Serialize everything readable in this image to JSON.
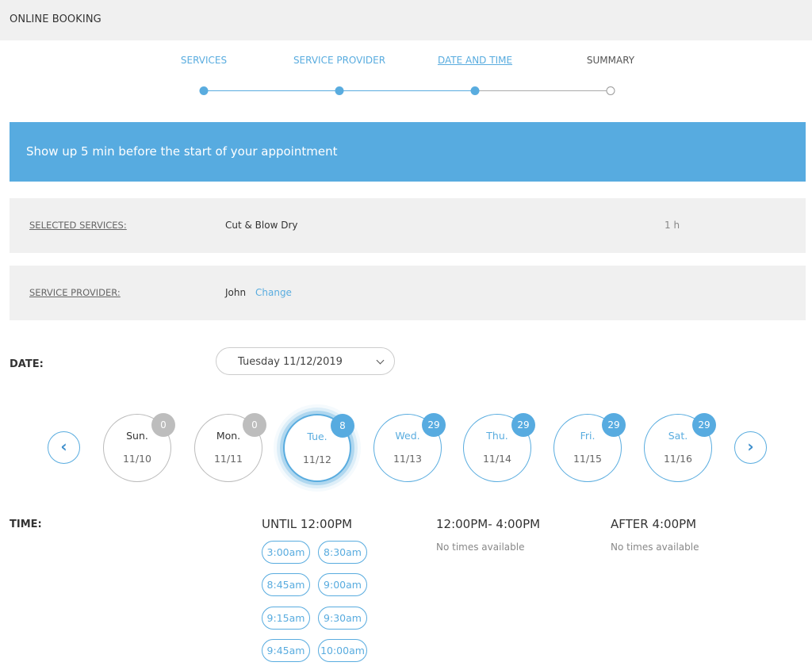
{
  "header": {
    "title": "ONLINE BOOKING"
  },
  "steps": [
    {
      "label": "SERVICES",
      "state": "done"
    },
    {
      "label": "SERVICE PROVIDER",
      "state": "done"
    },
    {
      "label": "DATE AND TIME",
      "state": "current"
    },
    {
      "label": "SUMMARY",
      "state": "pending"
    }
  ],
  "notice": {
    "text": "Show up 5 min before the start of your appointment"
  },
  "selected_services": {
    "label": "SELECTED SERVICES:",
    "value": "Cut & Blow Dry",
    "duration": "1 h"
  },
  "service_provider": {
    "label": "SERVICE PROVIDER:",
    "value": "John",
    "change_label": "Change"
  },
  "date": {
    "label": "DATE:",
    "selected_value": "Tuesday 11/12/2019",
    "prev_icon": "chevron-left-icon",
    "prev_glyph": "‹",
    "next_icon": "chevron-right-icon",
    "next_glyph": "›",
    "days": [
      {
        "name": "Sun.",
        "date": "11/10",
        "count": "0",
        "available": false,
        "selected": false
      },
      {
        "name": "Mon.",
        "date": "11/11",
        "count": "0",
        "available": false,
        "selected": false
      },
      {
        "name": "Tue.",
        "date": "11/12",
        "count": "8",
        "available": true,
        "selected": true
      },
      {
        "name": "Wed.",
        "date": "11/13",
        "count": "29",
        "available": true,
        "selected": false
      },
      {
        "name": "Thu.",
        "date": "11/14",
        "count": "29",
        "available": true,
        "selected": false
      },
      {
        "name": "Fri.",
        "date": "11/15",
        "count": "29",
        "available": true,
        "selected": false
      },
      {
        "name": "Sat.",
        "date": "11/16",
        "count": "29",
        "available": true,
        "selected": false
      }
    ]
  },
  "time": {
    "label": "TIME:",
    "groups": [
      {
        "title": "UNTIL 12:00PM",
        "slots": [
          "3:00am",
          "8:30am",
          "8:45am",
          "9:00am",
          "9:15am",
          "9:30am",
          "9:45am",
          "10:00am"
        ]
      },
      {
        "title": "12:00PM- 4:00PM",
        "empty_text": "No times available"
      },
      {
        "title": "AFTER 4:00PM",
        "empty_text": "No times available"
      }
    ]
  },
  "colors": {
    "accent": "#57abe0",
    "header_bg": "#f0f0f0",
    "unavailable_badge": "#bdbdbd"
  }
}
